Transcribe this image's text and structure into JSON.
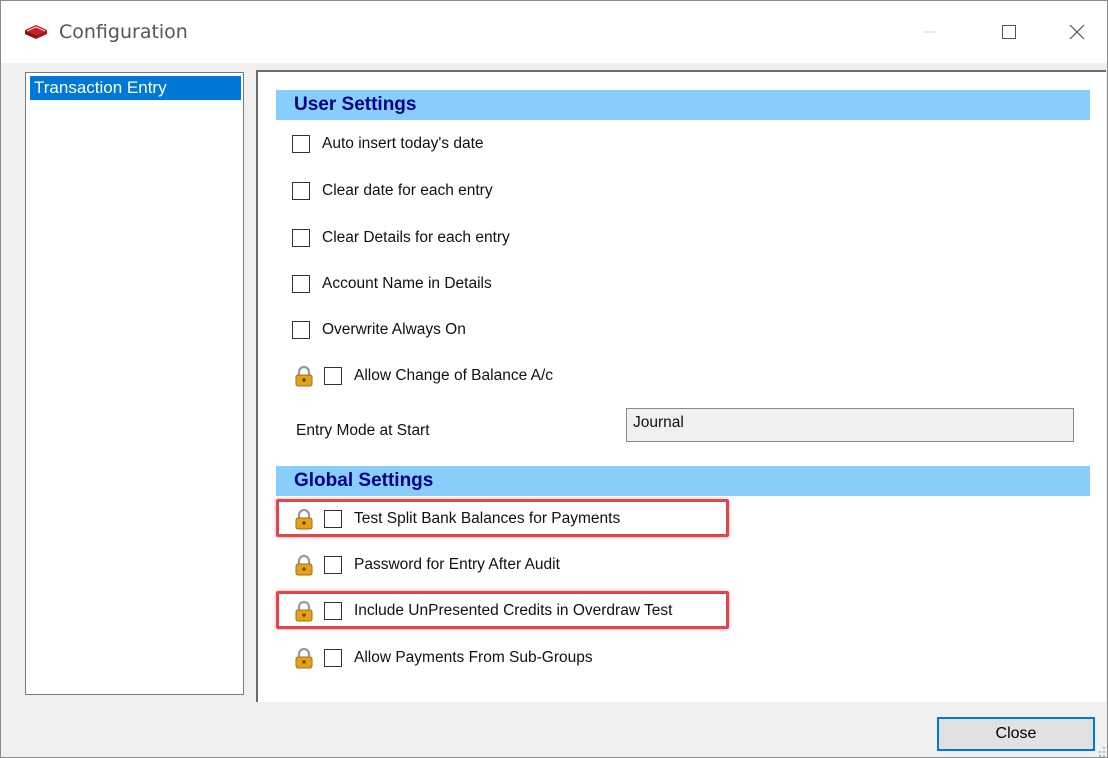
{
  "window": {
    "title": "Configuration",
    "icon": "red-book-icon"
  },
  "sidebar": {
    "items": [
      {
        "label": "Transaction Entry",
        "selected": true
      }
    ]
  },
  "user_settings": {
    "header": "User Settings",
    "options": [
      {
        "label": "Auto insert today's date",
        "checked": false,
        "locked": false
      },
      {
        "label": "Clear date for each entry",
        "checked": false,
        "locked": false
      },
      {
        "label": "Clear Details for each entry",
        "checked": false,
        "locked": false
      },
      {
        "label": "Account Name in Details",
        "checked": false,
        "locked": false
      },
      {
        "label": "Overwrite Always On",
        "checked": false,
        "locked": false
      },
      {
        "label": "Allow Change of Balance A/c",
        "checked": false,
        "locked": true
      }
    ],
    "entry_mode": {
      "label": "Entry Mode at Start",
      "value": "Journal"
    }
  },
  "global_settings": {
    "header": "Global Settings",
    "options": [
      {
        "label": "Test Split Bank Balances for Payments",
        "checked": false,
        "locked": true,
        "highlighted": true
      },
      {
        "label": "Password for Entry After Audit",
        "checked": false,
        "locked": true,
        "highlighted": false
      },
      {
        "label": "Include UnPresented Credits in Overdraw Test",
        "checked": false,
        "locked": true,
        "highlighted": true
      },
      {
        "label": "Allow Payments From Sub-Groups",
        "checked": false,
        "locked": true,
        "highlighted": false
      }
    ]
  },
  "footer": {
    "close_label": "Close"
  },
  "colors": {
    "section_header_bg": "#87cefa",
    "section_header_text": "#00008b",
    "selection": "#0078d7",
    "highlight_border": "#e0454e"
  }
}
